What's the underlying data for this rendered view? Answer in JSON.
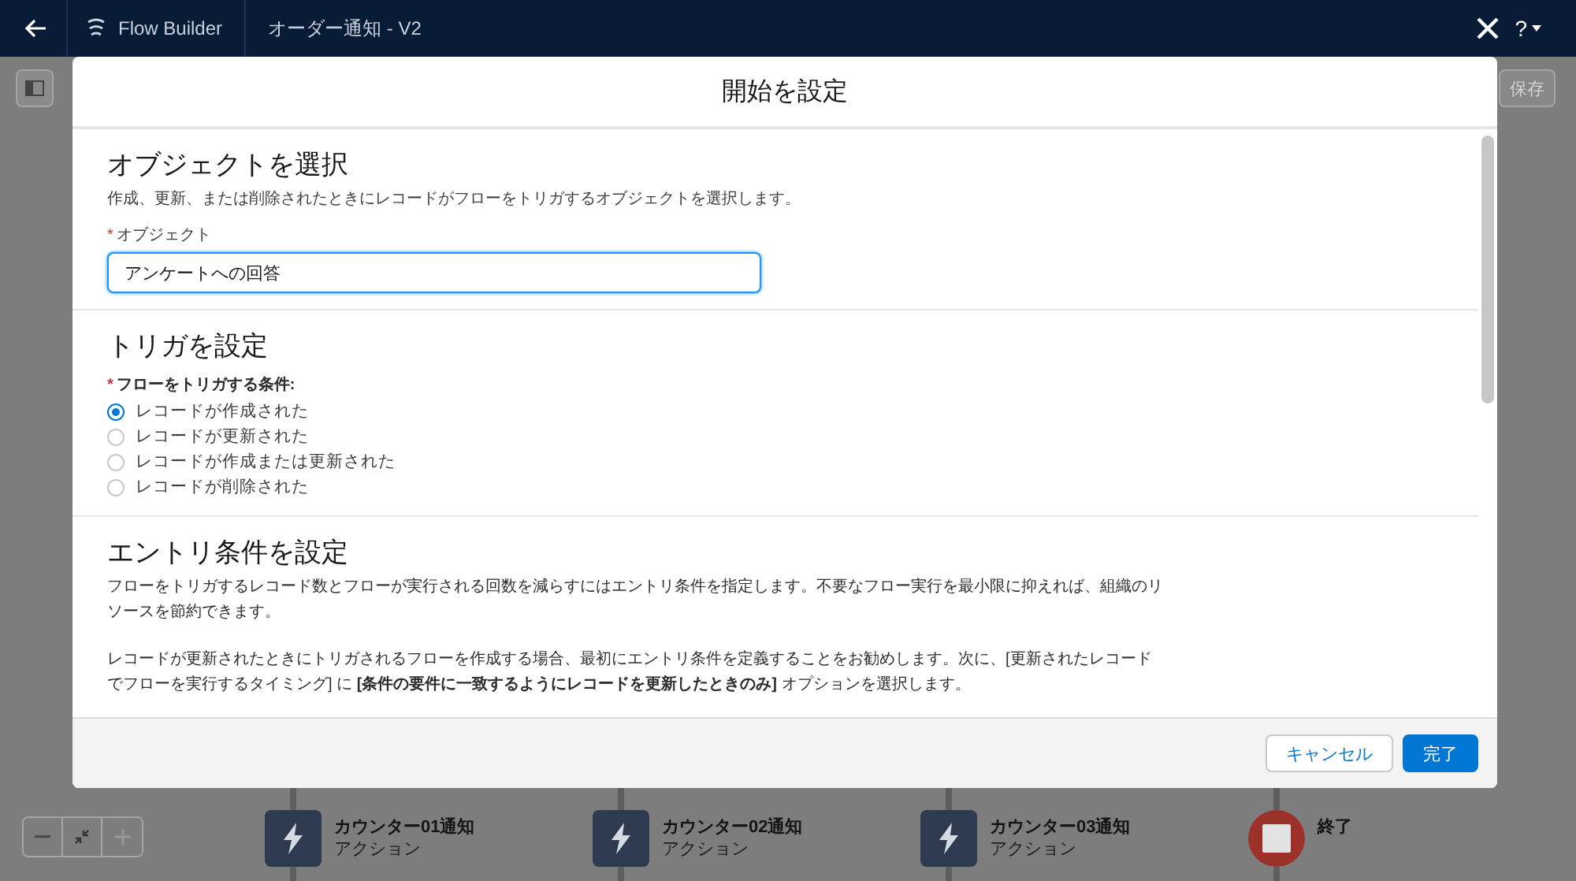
{
  "header": {
    "app_name": "Flow Builder",
    "flow_name": "オーダー通知 - V2",
    "help_label": "?"
  },
  "toolbar": {
    "save_label": "保存"
  },
  "modal": {
    "title": "開始を設定",
    "object_section": {
      "heading": "オブジェクトを選択",
      "description": "作成、更新、または削除されたときにレコードがフローをトリガするオブジェクトを選択します。",
      "field_label": "オブジェクト",
      "required_mark": "*",
      "value": "アンケートへの回答"
    },
    "trigger": {
      "heading": "トリガを設定",
      "label": "フローをトリガする条件:",
      "required_mark": "*",
      "options": [
        {
          "label": "レコードが作成された",
          "selected": true
        },
        {
          "label": "レコードが更新された",
          "selected": false
        },
        {
          "label": "レコードが作成または更新された",
          "selected": false
        },
        {
          "label": "レコードが削除された",
          "selected": false
        }
      ]
    },
    "entry": {
      "heading": "エントリ条件を設定",
      "paragraphs": [
        "フローをトリガするレコード数とフローが実行される回数を減らすにはエントリ条件を指定します。不要なフロー実行を最小限に抑えれば、組織のリソースを節約できます。",
        "レコードが更新されたときにトリガされるフローを作成する場合、最初にエントリ条件を定義することをお勧めします。次に、[更新されたレコードでフローを実行するタイミング] に **[条件の要件に一致するようにレコードを更新したときのみ]** オプションを選択します。"
      ]
    },
    "buttons": [
      {
        "kind": "neutral",
        "label": "キャンセル"
      },
      {
        "kind": "brand",
        "label": "完了"
      }
    ]
  },
  "canvas": {
    "nodes": [
      {
        "kind": "action",
        "title": "カウンター01通知",
        "subtitle": "アクション"
      },
      {
        "kind": "action",
        "title": "カウンター02通知",
        "subtitle": "アクション"
      },
      {
        "kind": "action",
        "title": "カウンター03通知",
        "subtitle": "アクション"
      },
      {
        "kind": "end",
        "title": "終了"
      }
    ]
  }
}
